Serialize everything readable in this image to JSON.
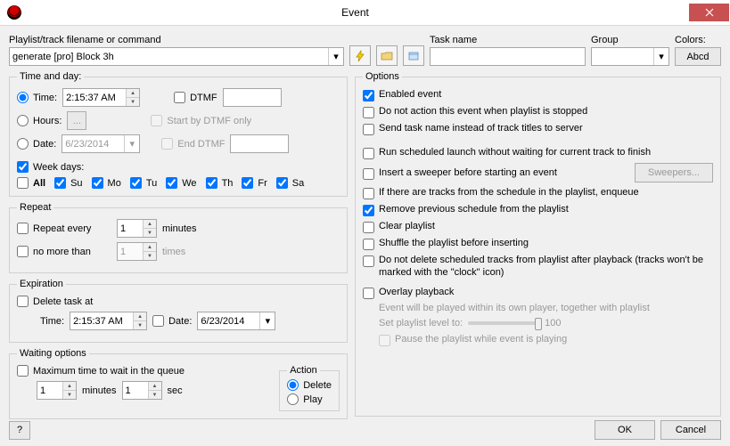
{
  "window": {
    "title": "Event"
  },
  "top": {
    "filename_label": "Playlist/track filename or command",
    "filename_value": "generate [pro] Block 3h",
    "taskname_label": "Task name",
    "taskname_value": "",
    "group_label": "Group",
    "group_value": "",
    "colors_label": "Colors:",
    "colors_sample": "Abcd"
  },
  "timeday": {
    "legend": "Time and day:",
    "time_label": "Time:",
    "time_value": "2:15:37 AM",
    "hours_label": "Hours:",
    "date_label": "Date:",
    "date_value": "6/23/2014",
    "dtmf_label": "DTMF",
    "dtmf_value": "",
    "start_dtmf_label": "Start by DTMF only",
    "end_dtmf_label": "End DTMF",
    "end_dtmf_value": "",
    "weekdays_label": "Week days:",
    "all_label": "All",
    "days": [
      "Su",
      "Mo",
      "Tu",
      "We",
      "Th",
      "Fr",
      "Sa"
    ]
  },
  "repeat": {
    "legend": "Repeat",
    "every_label": "Repeat every",
    "every_value": "1",
    "minutes": "minutes",
    "nomore_label": "no more than",
    "nomore_value": "1",
    "times": "times"
  },
  "expiration": {
    "legend": "Expiration",
    "delete_label": "Delete task at",
    "time_label": "Time:",
    "time_value": "2:15:37 AM",
    "date_label": "Date:",
    "date_value": "6/23/2014"
  },
  "waiting": {
    "legend": "Waiting options",
    "max_label": "Maximum time to wait in the queue",
    "min_value": "1",
    "min_label": "minutes",
    "sec_value": "1",
    "sec_label": "sec",
    "action_legend": "Action",
    "delete_label": "Delete",
    "play_label": "Play"
  },
  "options": {
    "legend": "Options",
    "enabled": "Enabled event",
    "noaction": "Do not action this event when playlist is stopped",
    "sendtask": "Send task name instead of track titles to server",
    "runsched": "Run scheduled launch without waiting for current track to finish",
    "sweeper": "Insert a sweeper before starting an event",
    "sweepers_btn": "Sweepers...",
    "enqueue": "If there are tracks from the schedule in the playlist, enqueue",
    "remove": "Remove previous schedule from the playlist",
    "clear": "Clear playlist",
    "shuffle": "Shuffle the playlist before inserting",
    "nodelete": "Do not delete scheduled tracks from playlist after playback (tracks won't be marked with the \"clock\" icon)",
    "overlay": "Overlay playback",
    "overlay_note": "Event will be played within its own player, together with playlist",
    "setlevel": "Set playlist level to:",
    "level_value": "100",
    "pause": "Pause the playlist while event is playing"
  },
  "buttons": {
    "help": "?",
    "ok": "OK",
    "cancel": "Cancel"
  }
}
